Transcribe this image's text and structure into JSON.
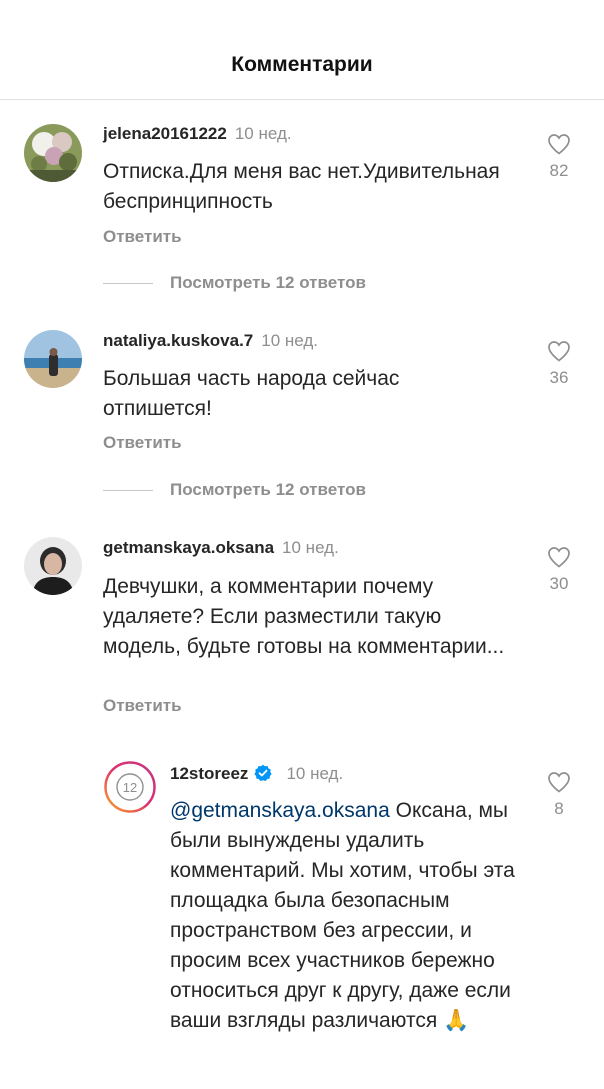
{
  "header": {
    "title": "Комментарии"
  },
  "comments": [
    {
      "username": "jelena20161222",
      "time": "10 нед.",
      "text": "Отписка.Для меня вас нет.Удивительная беспринципность",
      "reply_label": "Ответить",
      "likes": "82",
      "view_replies": "Посмотреть 12 ответов"
    },
    {
      "username": "nataliya.kuskova.7",
      "time": "10 нед.",
      "text": "Большая часть народа сейчас отпишется!",
      "reply_label": "Ответить",
      "likes": "36",
      "view_replies": "Посмотреть 12 ответов"
    },
    {
      "username": "getmanskaya.oksana",
      "time": "10 нед.",
      "text": "Девчушки, а комментарии почему удаляете? Если разместили такую модель, будьте готовы на комментарии...",
      "reply_label": "Ответить",
      "likes": "30"
    }
  ],
  "reply": {
    "username": "12storeez",
    "verified": true,
    "time": "10 нед.",
    "mention": "@getmanskaya.oksana",
    "text": " Оксана, мы были вынуждены удалить комментарий. Мы хотим, чтобы эта площадка была безопасным пространством без агрессии, и просим всех участников бережно относиться друг к другу, даже если ваши взгляды различаются",
    "emoji": "🙏",
    "likes": "8"
  },
  "colors": {
    "text": "#262626",
    "secondary": "#8e8e8e",
    "mention": "#00376b",
    "verified": "#0095f6"
  },
  "icons": [
    "heart-icon",
    "verified-badge-icon"
  ]
}
